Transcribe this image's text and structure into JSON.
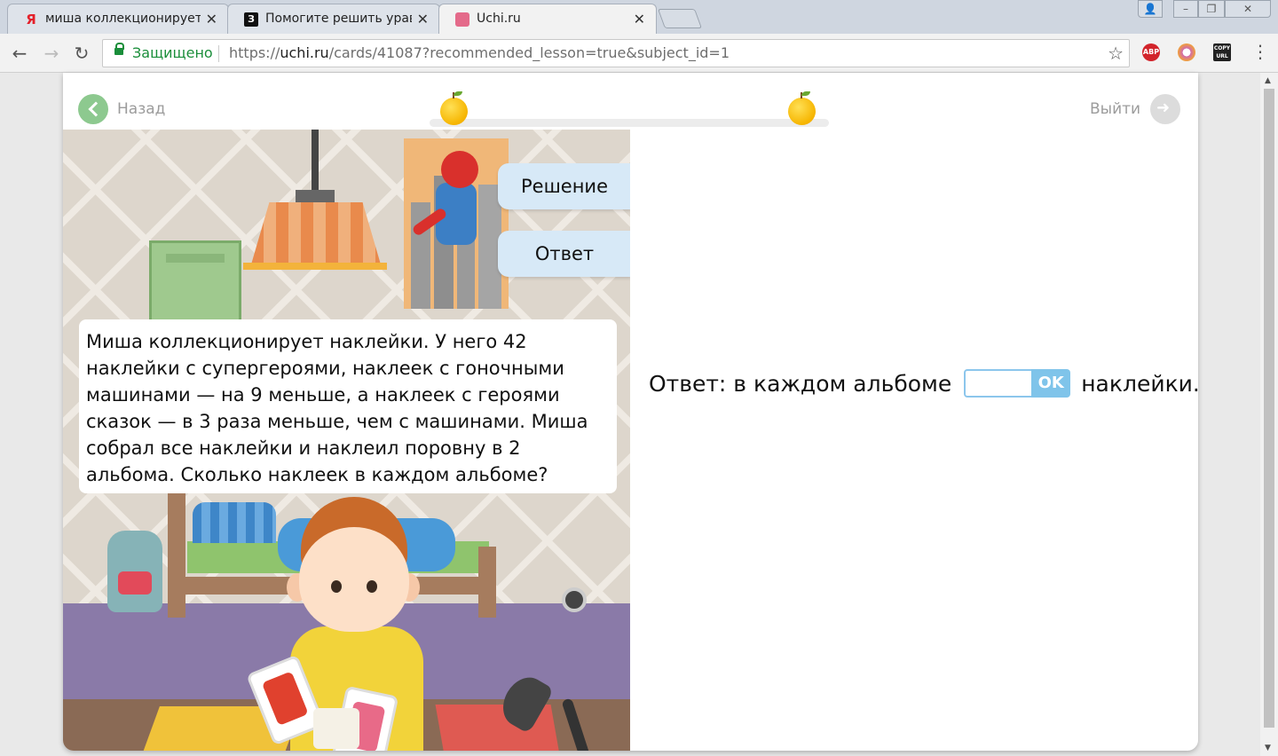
{
  "browser": {
    "tabs": [
      {
        "favicon": "Я",
        "title": "миша коллекционирует"
      },
      {
        "favicon": "З",
        "title": "Помогите решить урав"
      },
      {
        "favicon": "",
        "title": "Uchi.ru"
      }
    ],
    "secure_label": "Защищено",
    "url_scheme": "https://",
    "url_host": "uchi.ru",
    "url_path": "/cards/41087?recommended_lesson=true&subject_id=1",
    "extensions": [
      "ABP",
      "",
      "COPY URL"
    ]
  },
  "page": {
    "back_label": "Назад",
    "exit_label": "Выйти",
    "side_tabs": {
      "solution": "Решение",
      "answer": "Ответ"
    },
    "problem_text": "Миша коллекционирует наклейки. У него 42 наклейки с супергероями, наклеек с гоночными машинами — на 9 меньше, а наклеек с героями сказок — в 3 раза меньше, чем с машинами. Миша собрал все наклейки и наклеил поровну в 2 альбома. Сколько наклеек в каждом альбоме?",
    "answer_prefix": "Ответ: в каждом альбоме",
    "answer_value": "",
    "ok_label": "OK",
    "answer_suffix": "наклейки."
  },
  "colors": {
    "accent_green": "#8dc98f",
    "tab_blue": "#d7e9f7",
    "ok_blue": "#7fc4ea",
    "apple": "#f6b500"
  }
}
